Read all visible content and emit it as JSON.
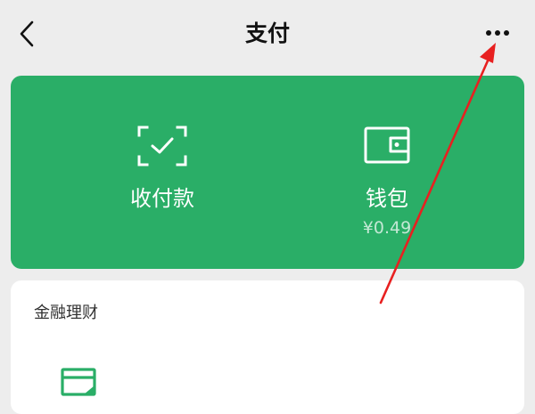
{
  "nav": {
    "title": "支付",
    "back_icon": "chevron-left-icon",
    "more_icon": "more-dots-icon"
  },
  "card": {
    "color": "#2aae67",
    "collect": {
      "label": "收付款",
      "icon": "scan-check-icon"
    },
    "wallet": {
      "label": "钱包",
      "balance": "¥0.49",
      "icon": "wallet-icon"
    }
  },
  "finance": {
    "title": "金融理财",
    "icon": "finance-card-icon"
  },
  "annotation": {
    "arrow_color": "#e82020"
  }
}
